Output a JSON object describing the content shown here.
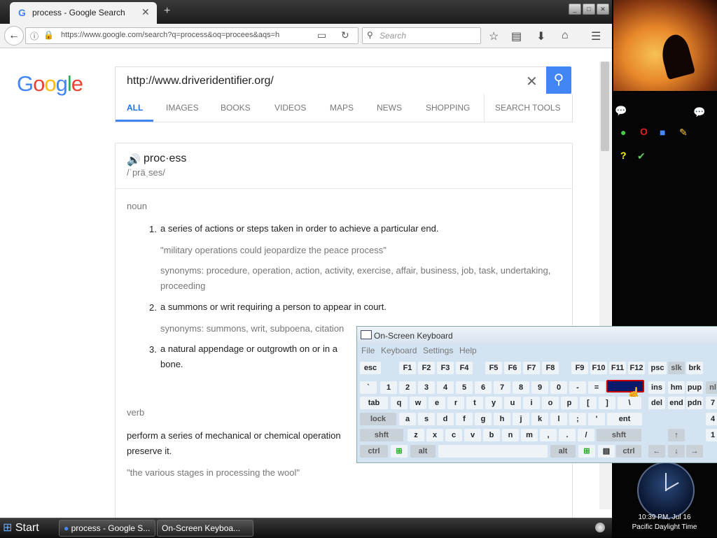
{
  "browser": {
    "tab_title": "process - Google Search",
    "tab_favicon": "G",
    "url": "https://www.google.com/search?q=process&oq=procees&aqs=h",
    "search_placeholder": "Search"
  },
  "google": {
    "logo": [
      "G",
      "o",
      "o",
      "g",
      "l",
      "e"
    ],
    "logo_colors": [
      "#4285f4",
      "#ea4335",
      "#fbbc05",
      "#4285f4",
      "#34a853",
      "#ea4335"
    ],
    "query": "http://www.driveridentifier.org/",
    "tabs": [
      "ALL",
      "IMAGES",
      "BOOKS",
      "VIDEOS",
      "MAPS",
      "NEWS",
      "SHOPPING",
      "SEARCH TOOLS"
    ],
    "active_tab": "ALL"
  },
  "definition": {
    "word": "proc·ess",
    "phonetic": "/ˈpräˌses/",
    "noun_label": "noun",
    "noun_defs": [
      {
        "num": "1.",
        "text": "a series of actions or steps taken in order to achieve a particular end.",
        "example": "\"military operations could jeopardize the peace process\"",
        "synonyms": "synonyms: procedure, operation, action, activity, exercise, affair, business, job, task, undertaking, proceeding"
      },
      {
        "num": "2.",
        "text": "a summons or writ requiring a person to appear in court.",
        "synonyms": "synonyms: summons, writ, subpoena, citation"
      },
      {
        "num": "3.",
        "text": "a natural appendage or outgrowth on or in a",
        "text_cont": "bone."
      }
    ],
    "verb_label": "verb",
    "verb_def": "perform a series of mechanical or chemical operation",
    "verb_def_cont": "preserve it.",
    "verb_example": "\"the various stages in processing the wool\""
  },
  "sidebar": {
    "clock_time": "10:39 PM, Jul 16",
    "clock_zone": "Pacific Daylight Time"
  },
  "taskbar": {
    "start": "Start",
    "tasks": [
      "process - Google S...",
      "On-Screen Keyboa..."
    ]
  },
  "osk": {
    "title": "On-Screen Keyboard",
    "menu": [
      "File",
      "Keyboard",
      "Settings",
      "Help"
    ],
    "row1": [
      "esc",
      "F1",
      "F2",
      "F3",
      "F4",
      "F5",
      "F6",
      "F7",
      "F8",
      "F9",
      "F10",
      "F11",
      "F12",
      "psc",
      "slk",
      "brk"
    ],
    "row2": [
      "`",
      "1",
      "2",
      "3",
      "4",
      "5",
      "6",
      "7",
      "8",
      "9",
      "0",
      "-",
      "=",
      "",
      "ins",
      "hm",
      "pup",
      "nl"
    ],
    "row3": [
      "tab",
      "q",
      "w",
      "e",
      "r",
      "t",
      "y",
      "u",
      "i",
      "o",
      "p",
      "[",
      "]",
      "\\",
      "del",
      "end",
      "pdn",
      "7"
    ],
    "row4": [
      "lock",
      "a",
      "s",
      "d",
      "f",
      "g",
      "h",
      "j",
      "k",
      "l",
      ";",
      "'",
      "ent",
      "4"
    ],
    "row5": [
      "shft",
      "z",
      "x",
      "c",
      "v",
      "b",
      "n",
      "m",
      ",",
      ".",
      "/",
      "shft",
      "↑",
      "1"
    ],
    "row6": [
      "ctrl",
      "⊞",
      "alt",
      "",
      "alt",
      "⊞",
      "▤",
      "ctrl",
      "←",
      "↓",
      "→"
    ]
  }
}
